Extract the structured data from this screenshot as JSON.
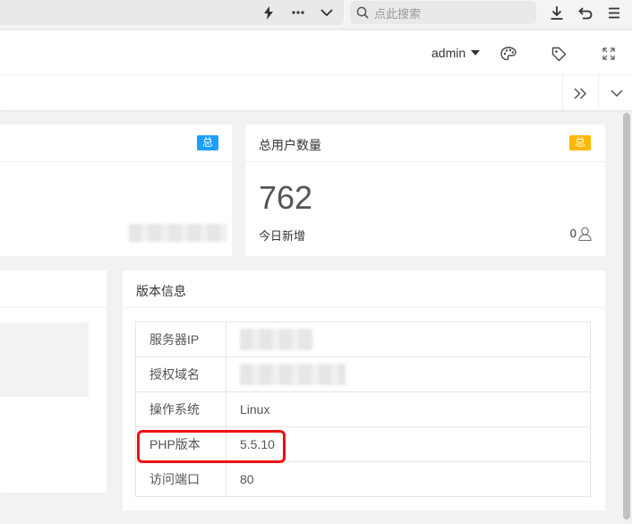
{
  "browser": {
    "search_placeholder": "点此搜索"
  },
  "header": {
    "username": "admin"
  },
  "card_left": {
    "badge": "总",
    "badge_color": "#1e9fff"
  },
  "card_users": {
    "title": "总用户数量",
    "badge": "总",
    "badge_color": "#ffb800",
    "value": "762",
    "today_label": "今日新增",
    "today_value": "0"
  },
  "version": {
    "title": "版本信息",
    "rows": [
      {
        "key": "服务器IP",
        "value": ""
      },
      {
        "key": "授权域名",
        "value": ""
      },
      {
        "key": "操作系统",
        "value": "Linux"
      },
      {
        "key": "PHP版本",
        "value": "5.5.10"
      },
      {
        "key": "访问端口",
        "value": "80"
      }
    ]
  },
  "highlight_color": "#ee1111"
}
